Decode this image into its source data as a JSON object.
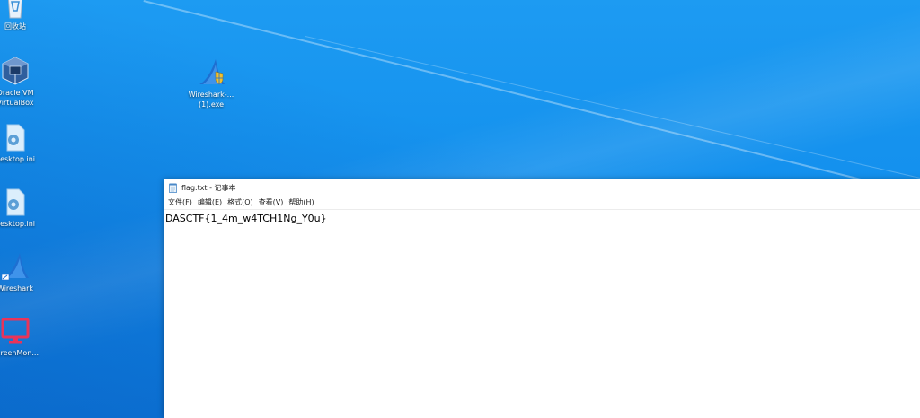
{
  "desktop": {
    "icons": [
      {
        "label": "回收站",
        "icon": "recycle-bin-icon"
      },
      {
        "label": "Oracle VM\nVirtualBox",
        "icon": "virtualbox-icon"
      },
      {
        "label": "desktop.ini",
        "icon": "settings-file-icon"
      },
      {
        "label": "desktop.ini",
        "icon": "settings-file-icon"
      },
      {
        "label": "Wireshark",
        "icon": "wireshark-icon"
      },
      {
        "label": "ScreenMon...",
        "icon": "monitor-icon"
      },
      {
        "label": "Wireshark-...\n(1).exe",
        "icon": "wireshark-installer-icon"
      }
    ]
  },
  "notepad": {
    "title": "flag.txt - 记事本",
    "menu": [
      "文件(F)",
      "编辑(E)",
      "格式(O)",
      "查看(V)",
      "帮助(H)"
    ],
    "content": "DASCTF{1_4m_w4TCH1Ng_Y0u}"
  },
  "colors": {
    "desktop_blue": "#1592ee",
    "window_bg": "#ffffff",
    "monitor_pink": "#e8345a"
  }
}
